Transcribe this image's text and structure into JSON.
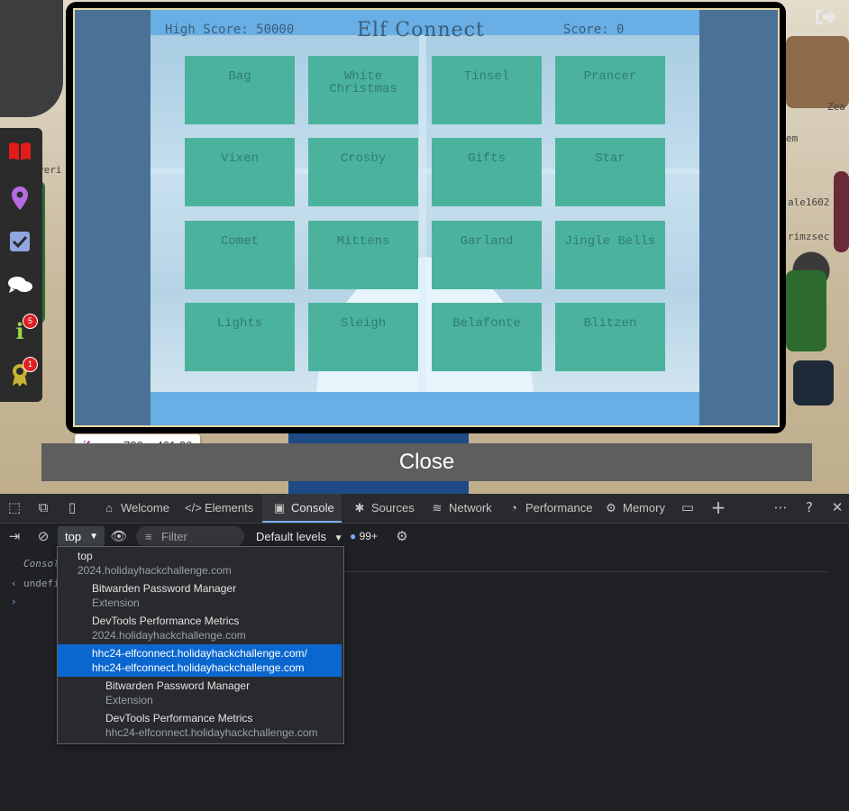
{
  "game": {
    "high_score": "High Score: 50000",
    "title": "Elf Connect",
    "score": "Score: 0",
    "tiles": [
      "Bag",
      "White Christmas",
      "Tinsel",
      "Prancer",
      "Vixen",
      "Crosby",
      "Gifts",
      "Star",
      "Comet",
      "Mittens",
      "Garland",
      "Jingle Bells",
      "Lights",
      "Sleigh",
      "Belafonte",
      "Blitzen"
    ]
  },
  "world": {
    "names": [
      "veri",
      "Zea",
      "em",
      "ale1602",
      "rimzsec"
    ]
  },
  "sidebar": {
    "info_badge": "5",
    "award_badge": "1"
  },
  "inspector_tip": {
    "tag": "iframe",
    "dims": "780 × 461.36"
  },
  "close_label": "Close",
  "devtools": {
    "tabs": [
      "Welcome",
      "Elements",
      "Console",
      "Sources",
      "Network",
      "Performance",
      "Memory"
    ],
    "active_tab": "Console",
    "context_value": "top",
    "filter_placeholder": "Filter",
    "levels_label": "Default levels",
    "issues_count": "99+",
    "console_lines": [
      "Consol",
      "undefi"
    ],
    "context_menu": [
      {
        "title": "top",
        "sub": "2024.holidayhackchallenge.com"
      },
      {
        "title": "Bitwarden Password Manager",
        "sub": "Extension"
      },
      {
        "title": "DevTools Performance Metrics",
        "sub": "2024.holidayhackchallenge.com"
      },
      {
        "title": "hhc24-elfconnect.holidayhackchallenge.com/",
        "sub": "hhc24-elfconnect.holidayhackchallenge.com"
      },
      {
        "title": "Bitwarden Password Manager",
        "sub": "Extension"
      },
      {
        "title": "DevTools Performance Metrics",
        "sub": "hhc24-elfconnect.holidayhackchallenge.com"
      }
    ]
  },
  "colors": {
    "tile": "#4bb39d",
    "tile_text": "#2f7d72",
    "selected": "#0b67d0",
    "accent_tab": "#7cacf8"
  }
}
